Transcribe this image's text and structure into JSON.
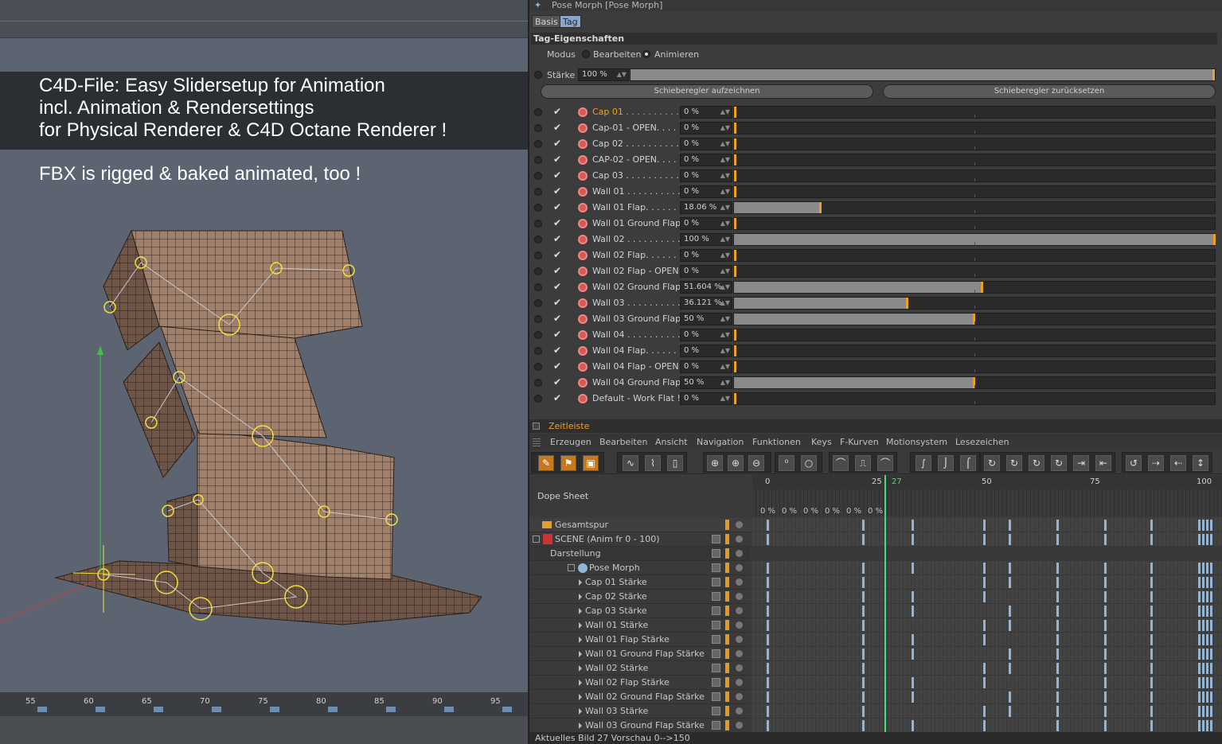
{
  "viewport": {
    "banner_lines": [
      "C4D-File: Easy Slidersetup for Animation",
      "incl. Animation & Rendersettings",
      "for Physical Renderer & C4D Octane Renderer !"
    ],
    "fbx_line": "FBX is rigged & baked animated, too !",
    "ruler_ticks": [
      "55",
      "60",
      "65",
      "70",
      "75",
      "80",
      "85",
      "90",
      "95"
    ]
  },
  "attr": {
    "title": "Pose Morph [Pose Morph]",
    "tabs": [
      "Basis",
      "Tag"
    ],
    "section": "Tag-Eigenschaften",
    "modus_label": "Modus",
    "mode_edit": "Bearbeiten",
    "mode_animate": "Animieren",
    "staerke_label": "Stärke",
    "staerke_value": "100 %",
    "btn_record": "Schieberegler aufzeichnen",
    "btn_reset": "Schieberegler zurücksetzen",
    "morphs": [
      {
        "label": "Cap 01 . . . . . . . . . . .",
        "value": "0 %",
        "pct": 0,
        "active": true
      },
      {
        "label": "Cap-01 - OPEN. . . . .",
        "value": "0 %",
        "pct": 0
      },
      {
        "label": "Cap 02 . . . . . . . . . . .",
        "value": "0 %",
        "pct": 0
      },
      {
        "label": "CAP-02 - OPEN. . . . .",
        "value": "0 %",
        "pct": 0
      },
      {
        "label": "Cap 03 . . . . . . . . . . .",
        "value": "0 %",
        "pct": 0
      },
      {
        "label": "Wall 01 . . . . . . . . . . .",
        "value": "0 %",
        "pct": 0
      },
      {
        "label": "Wall 01 Flap. . . . . . .",
        "value": "18.06 %",
        "pct": 18.06
      },
      {
        "label": "Wall 01 Ground Flap",
        "value": "0 %",
        "pct": 0
      },
      {
        "label": "Wall 02 . . . . . . . . . . .",
        "value": "100 %",
        "pct": 100
      },
      {
        "label": "Wall 02 Flap. . . . . . .",
        "value": "0 %",
        "pct": 0
      },
      {
        "label": "Wall 02 Flap - OPEN",
        "value": "0 %",
        "pct": 0
      },
      {
        "label": "Wall 02 Ground Flap",
        "value": "51.604 %",
        "pct": 51.604
      },
      {
        "label": "Wall 03 . . . . . . . . . . .",
        "value": "36.121 %",
        "pct": 36.121
      },
      {
        "label": "Wall 03 Ground Flap",
        "value": "50 %",
        "pct": 50
      },
      {
        "label": "Wall 04 . . . . . . . . . . .",
        "value": "0 %",
        "pct": 0
      },
      {
        "label": "Wall 04 Flap. . . . . . .",
        "value": "0 %",
        "pct": 0
      },
      {
        "label": "Wall 04 Flap - OPEN",
        "value": "0 %",
        "pct": 0
      },
      {
        "label": "Wall 04 Ground Flap",
        "value": "50 %",
        "pct": 50
      },
      {
        "label": "Default - Work Flat !",
        "value": "0 %",
        "pct": 0
      }
    ]
  },
  "timeline": {
    "title": "Zeitleiste",
    "menu": [
      "Erzeugen",
      "Bearbeiten",
      "Ansicht",
      "Navigation",
      "Funktionen",
      "Keys",
      "F-Kurven",
      "Motionsystem",
      "Lesezeichen"
    ],
    "dope_label": "Dope Sheet",
    "frame_ticks": [
      "0",
      "25",
      "27",
      "50",
      "75",
      "100"
    ],
    "pct_labels": [
      "0 %",
      "0 %",
      "0 %",
      "0 %",
      "0 %",
      "0 %"
    ],
    "tracks": [
      {
        "label": "Gesamtspur",
        "indent": 0
      },
      {
        "label": "SCENE (Anim fr 0 - 100)",
        "indent": 1
      },
      {
        "label": "Darstellung",
        "indent": 2
      },
      {
        "label": "Pose Morph",
        "indent": 3
      },
      {
        "label": "Cap 01 Stärke",
        "indent": 4
      },
      {
        "label": "Cap 02 Stärke",
        "indent": 4
      },
      {
        "label": "Cap 03 Stärke",
        "indent": 4
      },
      {
        "label": "Wall 01 Stärke",
        "indent": 4
      },
      {
        "label": "Wall 01 Flap Stärke",
        "indent": 4
      },
      {
        "label": "Wall 01 Ground Flap Stärke",
        "indent": 4
      },
      {
        "label": "Wall 02 Stärke",
        "indent": 4
      },
      {
        "label": "Wall 02 Flap Stärke",
        "indent": 4
      },
      {
        "label": "Wall 02 Ground Flap Stärke",
        "indent": 4
      },
      {
        "label": "Wall 03 Stärke",
        "indent": 4
      },
      {
        "label": "Wall 03 Ground Flap Stärke",
        "indent": 4
      }
    ],
    "status": "Aktuelles Bild  27  Vorschau  0-->150"
  },
  "colors": {
    "accent": "#f0a020",
    "key": "#8fb6d8",
    "playhead": "#3ee07a"
  }
}
